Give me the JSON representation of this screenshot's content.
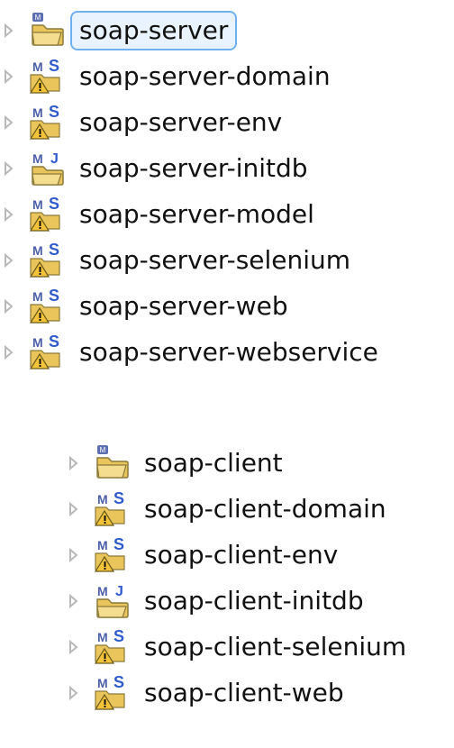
{
  "project_explorer": {
    "server_projects": [
      {
        "label": "soap-server",
        "icon": "folder-project-icon",
        "selected": true
      },
      {
        "label": "soap-server-domain",
        "icon": "maven-s-icon"
      },
      {
        "label": "soap-server-env",
        "icon": "maven-s-icon"
      },
      {
        "label": "soap-server-initdb",
        "icon": "maven-j-icon"
      },
      {
        "label": "soap-server-model",
        "icon": "maven-s-icon"
      },
      {
        "label": "soap-server-selenium",
        "icon": "maven-s-icon"
      },
      {
        "label": "soap-server-web",
        "icon": "maven-s-icon"
      },
      {
        "label": "soap-server-webservice",
        "icon": "maven-s-icon"
      }
    ],
    "client_projects": [
      {
        "label": "soap-client",
        "icon": "folder-project-icon"
      },
      {
        "label": "soap-client-domain",
        "icon": "maven-s-icon"
      },
      {
        "label": "soap-client-env",
        "icon": "maven-s-icon"
      },
      {
        "label": "soap-client-initdb",
        "icon": "maven-j-icon"
      },
      {
        "label": "soap-client-selenium",
        "icon": "maven-s-icon"
      },
      {
        "label": "soap-client-web",
        "icon": "maven-s-icon"
      }
    ]
  },
  "colors": {
    "selection_outline": "#6fb0f0",
    "selection_fill": "#e8f3ff",
    "chevron": "#b8b8b8",
    "label_text": "#111111",
    "folder_yellow": "#e9c55b",
    "maven_s_blue": "#2f5bcc",
    "maven_m_blue": "#4b5fa8",
    "warning_yellow": "#f3c43a"
  }
}
